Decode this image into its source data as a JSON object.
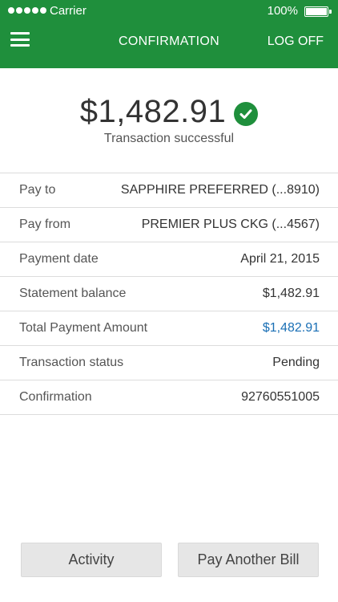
{
  "status_bar": {
    "carrier": "Carrier",
    "battery_percent": "100%",
    "signal_icon": "signal-dots-icon",
    "battery_icon": "battery-icon"
  },
  "nav": {
    "menu_icon": "hamburger-menu-icon",
    "title": "CONFIRMATION",
    "logoff_label": "LOG OFF"
  },
  "summary": {
    "amount": "$1,482.91",
    "status_text": "Transaction successful",
    "check_icon": "check-circle-icon"
  },
  "details": [
    {
      "label": "Pay to",
      "value": "SAPPHIRE PREFERRED  (...8910)"
    },
    {
      "label": "Pay from",
      "value": "PREMIER PLUS CKG  (...4567)"
    },
    {
      "label": "Payment date",
      "value": "April 21, 2015"
    },
    {
      "label": "Statement balance",
      "value": "$1,482.91"
    },
    {
      "label": "Total Payment Amount",
      "value": "$1,482.91",
      "highlight": true
    },
    {
      "label": "Transaction status",
      "value": "Pending"
    },
    {
      "label": "Confirmation",
      "value": "92760551005"
    }
  ],
  "buttons": {
    "activity_label": "Activity",
    "pay_another_label": "Pay Another Bill"
  },
  "colors": {
    "brand_green": "#1f8f3c",
    "link_blue": "#1a6fb5",
    "divider": "#dcdcdc",
    "button_bg": "#e6e6e6"
  }
}
